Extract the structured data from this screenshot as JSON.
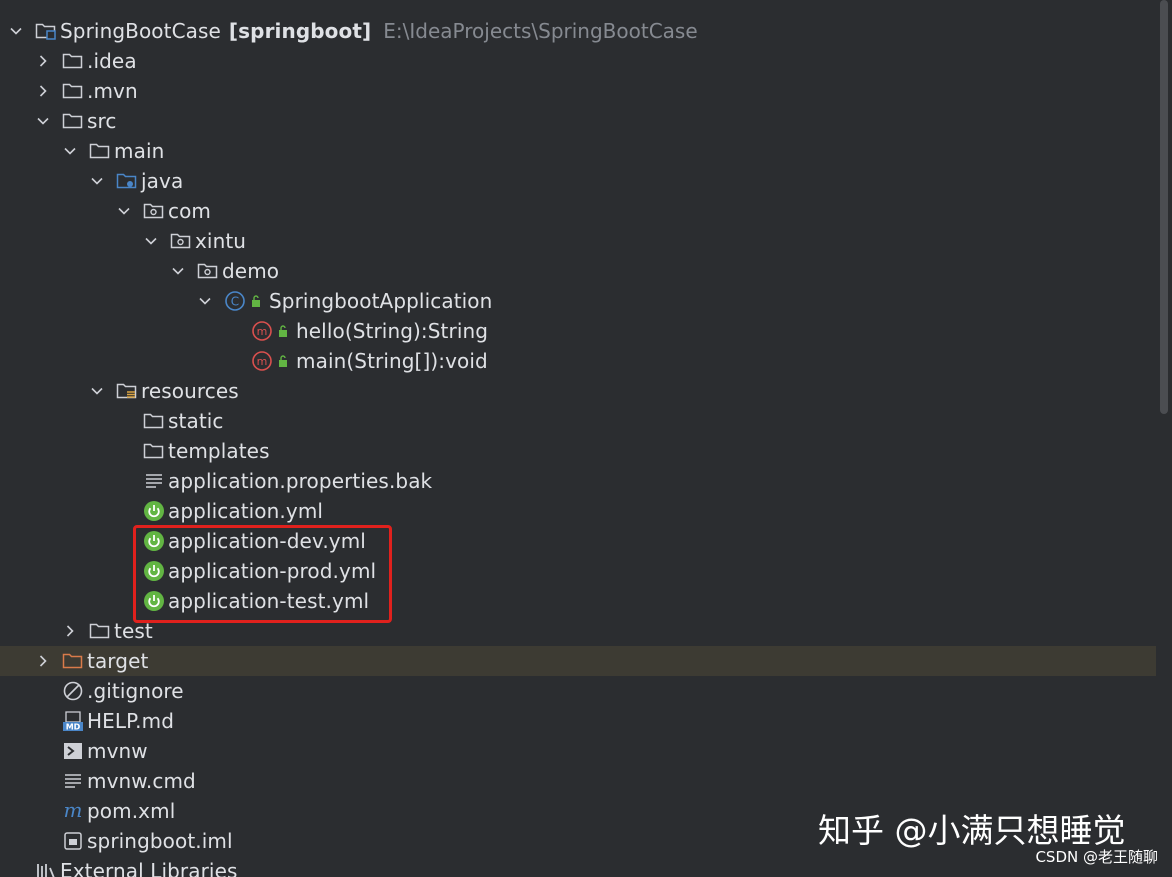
{
  "project": {
    "name": "SpringBootCase",
    "module": "[springboot]",
    "path": "E:\\IdeaProjects\\SpringBootCase"
  },
  "tree": {
    "idea": ".idea",
    "mvn": ".mvn",
    "src": "src",
    "main": "main",
    "java": "java",
    "com": "com",
    "xintu": "xintu",
    "demo": "demo",
    "app_class": "SpringbootApplication",
    "method_hello": "hello(String):String",
    "method_main": "main(String[]):void",
    "resources": "resources",
    "static": "static",
    "templates": "templates",
    "props_bak": "application.properties.bak",
    "app_yml": "application.yml",
    "app_dev": "application-dev.yml",
    "app_prod": "application-prod.yml",
    "app_test": "application-test.yml",
    "test": "test",
    "target": "target",
    "gitignore": ".gitignore",
    "help": "HELP.md",
    "mvnw": "mvnw",
    "mvnw_cmd": "mvnw.cmd",
    "pom": "pom.xml",
    "iml": "springboot.iml",
    "ext_libs": "External Libraries"
  },
  "watermark": {
    "main": "知乎 @小满只想睡觉",
    "small": "CSDN @老王随聊"
  },
  "colors": {
    "background": "#2b2d30",
    "text": "#dfe1e5",
    "path_text": "#868a91",
    "excluded_row": "#3d3b33",
    "highlight_border": "#e0211d",
    "spring_green": "#62b543",
    "method_red": "#d9504e",
    "class_blue": "#4a86c8"
  },
  "icons": {
    "folder": "folder-icon",
    "package": "package-icon",
    "source_root": "source-root-icon",
    "resources_root": "resources-root-icon",
    "excluded_folder": "excluded-folder-icon",
    "class": "class-icon",
    "method": "method-icon",
    "spring_config": "spring-config-icon",
    "text_file": "text-file-icon",
    "ignore_file": "ignore-file-icon",
    "markdown_file": "markdown-file-icon",
    "shell_file": "shell-script-icon",
    "maven_file": "maven-icon",
    "module_file": "module-file-icon",
    "library": "library-icon"
  }
}
